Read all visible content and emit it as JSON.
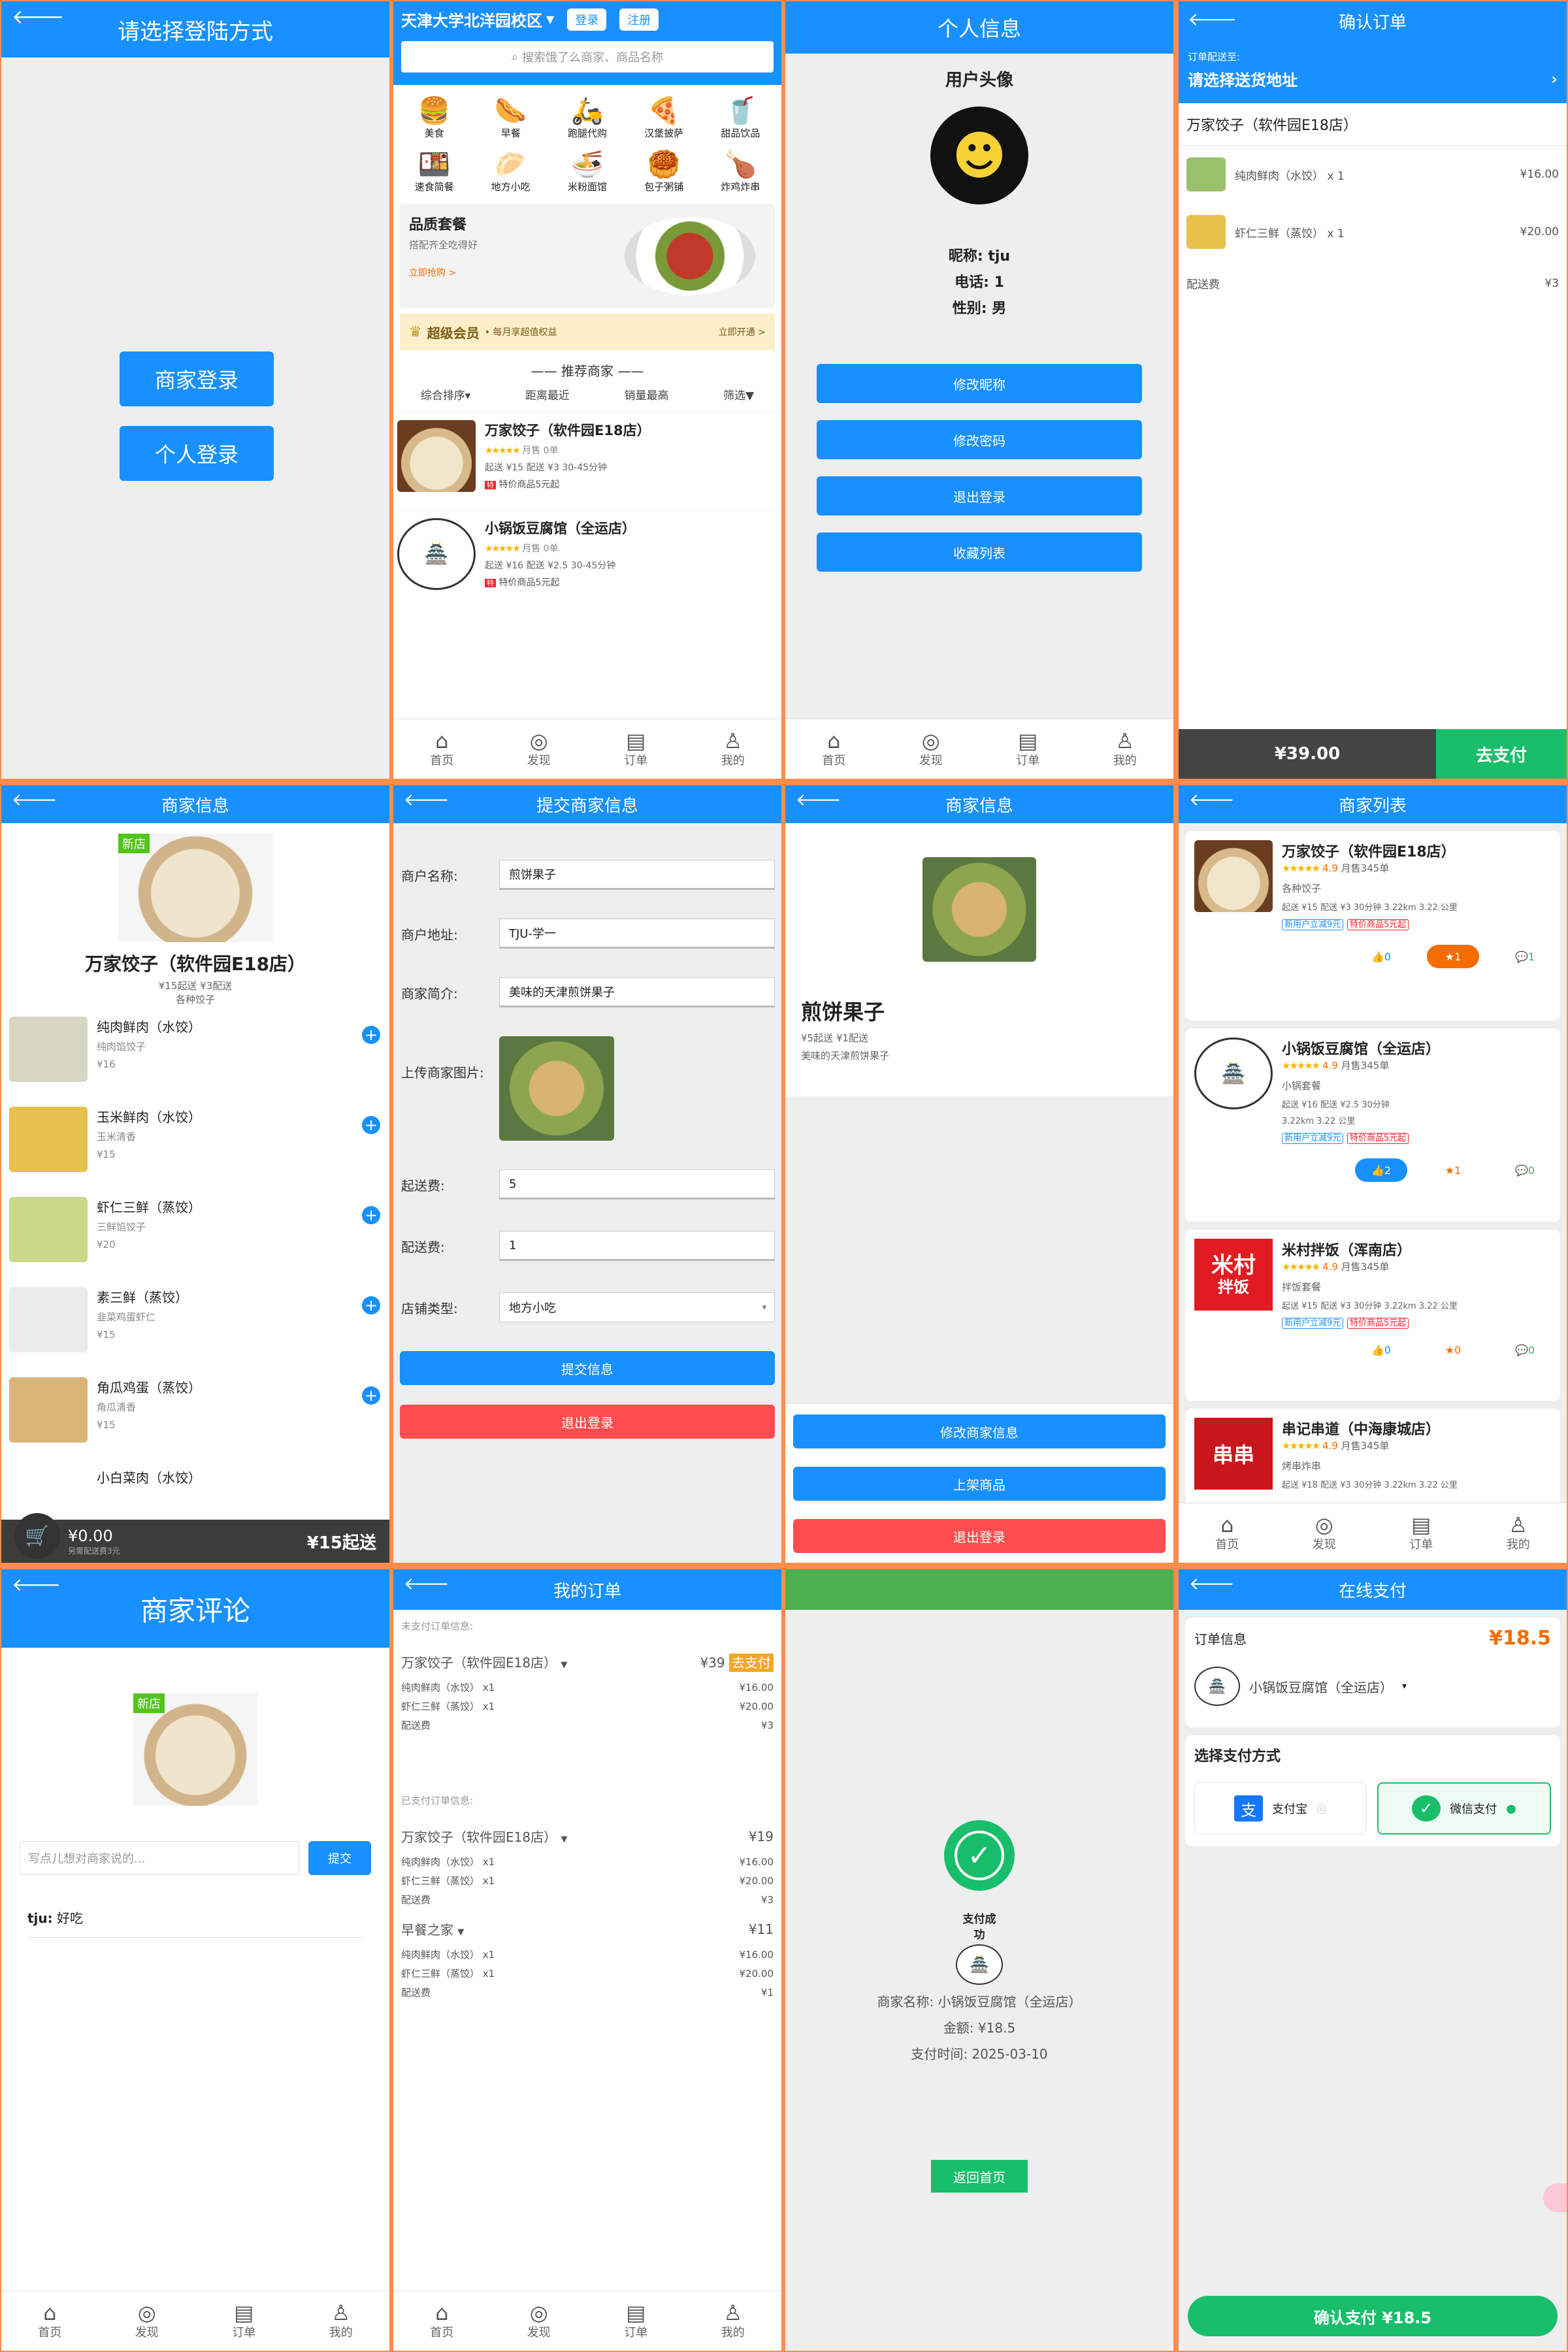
{
  "tabbar": [
    "首页",
    "发现",
    "订单",
    "我的"
  ],
  "login": {
    "title": "请选择登陆方式",
    "merchant_btn": "商家登录",
    "personal_btn": "个人登录"
  },
  "home": {
    "location": "天津大学北洋园校区",
    "login": "登录",
    "register": "注册",
    "search_placeholder": "搜索饿了么商家、商品名称",
    "cats": [
      "美食",
      "早餐",
      "跑腿代购",
      "汉堡披萨",
      "甜品饮品",
      "速食简餐",
      "地方小吃",
      "米粉面馆",
      "包子粥铺",
      "炸鸡炸串"
    ],
    "banner_title": "品质套餐",
    "banner_sub": "搭配齐全吃得好",
    "banner_link": "立即抢购 >",
    "vip": "超级会员",
    "vip_sub": "• 每月享超值权益",
    "vip_link": "立即开通 >",
    "rec_title": "推荐商家",
    "sorts": [
      "综合排序▾",
      "距离最近",
      "销量最高",
      "筛选▼"
    ],
    "shops": [
      {
        "name": "万家饺子（软件园E18店）",
        "sales": "月售 0单",
        "fee": "起送 ¥15  配送 ¥3  30-45分钟",
        "promo": "特价商品5元起"
      },
      {
        "name": "小锅饭豆腐馆（全运店）",
        "sales": "月售 0单",
        "fee": "起送 ¥16  配送 ¥2.5  30-45分钟",
        "promo": "特价商品5元起"
      }
    ]
  },
  "profile": {
    "title": "个人信息",
    "avatar_label": "用户头像",
    "nick": "昵称: tju",
    "phone": "电话: 1",
    "gender": "性别: 男",
    "buttons": [
      "修改昵称",
      "修改密码",
      "退出登录",
      "收藏列表"
    ]
  },
  "confirm": {
    "title": "确认订单",
    "deliver_to": "订单配送至:",
    "choose_addr": "请选择送货地址",
    "shop": "万家饺子（软件园E18店）",
    "items": [
      {
        "name": "纯肉鲜肉（水饺） x 1",
        "price": "¥16.00"
      },
      {
        "name": "虾仁三鲜（蒸饺） x 1",
        "price": "¥20.00"
      }
    ],
    "fee_label": "配送费",
    "fee": "¥3",
    "total": "¥39.00",
    "pay": "去支付"
  },
  "shopinfo": {
    "title": "商家信息",
    "name": "万家饺子（软件园E18店）",
    "meta": "¥15起送 ¥3配送",
    "desc": "各种饺子",
    "items": [
      {
        "name": "纯肉鲜肉（水饺）",
        "desc": "纯肉馅饺子",
        "price": "¥16"
      },
      {
        "name": "玉米鲜肉（水饺）",
        "desc": "玉米清香",
        "price": "¥15"
      },
      {
        "name": "虾仁三鲜（蒸饺）",
        "desc": "三鲜馅饺子",
        "price": "¥20"
      },
      {
        "name": "素三鲜（蒸饺）",
        "desc": "韭菜鸡蛋虾仁",
        "price": "¥15"
      },
      {
        "name": "角瓜鸡蛋（蒸饺）",
        "desc": "角瓜清香",
        "price": "¥15"
      },
      {
        "name": "小白菜肉（水饺）",
        "desc": "",
        "price": ""
      }
    ],
    "cart_amount": "¥0.00",
    "cart_note": "另需配送费3元",
    "min_order": "¥15起送",
    "new_tag": "新店"
  },
  "submit": {
    "title": "提交商家信息",
    "fields": [
      {
        "label": "商户名称:",
        "value": "煎饼果子"
      },
      {
        "label": "商户地址:",
        "value": "TJU-学一"
      },
      {
        "label": "商家简介:",
        "value": "美味的天津煎饼果子"
      }
    ],
    "upload_label": "上传商家图片:",
    "fields2": [
      {
        "label": "起送费:",
        "value": "5"
      },
      {
        "label": "配送费:",
        "value": "1"
      },
      {
        "label": "店铺类型:",
        "value": "地方小吃"
      }
    ],
    "submit_btn": "提交信息",
    "logout_btn": "退出登录"
  },
  "merchant": {
    "title": "商家信息",
    "name": "煎饼果子",
    "meta": "¥5起送 ¥1配送",
    "desc": "美味的天津煎饼果子",
    "buttons": [
      "修改商家信息",
      "上架商品",
      "退出登录"
    ]
  },
  "shoplist": {
    "title": "商家列表",
    "shops": [
      {
        "name": "万家饺子（软件园E18店）",
        "rating": "4.9",
        "sales": "月售345单",
        "cat": "各种饺子",
        "fee": "起送 ¥15   配送 ¥3   30分钟   3.22km  3.22 公里",
        "likes": "0",
        "stars": "1",
        "comments": "1",
        "tag1": "新用户立减9元",
        "tag2": "特价商品5元起"
      },
      {
        "name": "小锅饭豆腐馆（全运店）",
        "rating": "4.9",
        "sales": "月售345单",
        "cat": "小锅套餐",
        "fee": "起送 ¥16   配送 ¥2.5   30分钟",
        "fee2": "3.22km  3.22 公里",
        "likes": "2",
        "stars": "1",
        "comments": "0",
        "tag1": "新用户立减9元",
        "tag2": "特价商品5元起"
      },
      {
        "name": "米村拌饭（浑南店）",
        "rating": "4.9",
        "sales": "月售345单",
        "cat": "拌饭套餐",
        "fee": "起送 ¥15   配送 ¥3   30分钟   3.22km  3.22 公里",
        "likes": "0",
        "stars": "0",
        "comments": "0",
        "tag1": "新用户立减9元",
        "tag2": "特价商品5元起"
      },
      {
        "name": "串记串道（中海康城店）",
        "rating": "4.9",
        "sales": "月售345单",
        "cat": "烤串炸串",
        "fee": "起送 ¥18   配送 ¥3   30分钟   3.22km  3.22 公里"
      }
    ]
  },
  "reviews": {
    "title": "商家评论",
    "placeholder": "写点儿想对商家说的...",
    "submit": "提交",
    "comment_user": "tju:",
    "comment_text": "好吃"
  },
  "orders": {
    "title": "我的订单",
    "unpaid_label": "未支付订单信息:",
    "paid_label": "已支付订单信息:",
    "unpaid": [
      {
        "shop": "万家饺子（软件园E18店）",
        "total": "¥39",
        "pay": "去支付",
        "lines": [
          [
            "纯肉鲜肉（水饺） x1",
            "¥16.00"
          ],
          [
            "虾仁三鲜（蒸饺） x1",
            "¥20.00"
          ],
          [
            "配送费",
            "¥3"
          ]
        ]
      }
    ],
    "paid": [
      {
        "shop": "万家饺子（软件园E18店）",
        "total": "¥19",
        "lines": [
          [
            "纯肉鲜肉（水饺） x1",
            "¥16.00"
          ],
          [
            "虾仁三鲜（蒸饺） x1",
            "¥20.00"
          ],
          [
            "配送费",
            "¥3"
          ]
        ]
      },
      {
        "shop": "早餐之家",
        "total": "¥11",
        "lines": [
          [
            "纯肉鲜肉（水饺） x1",
            "¥16.00"
          ],
          [
            "虾仁三鲜（蒸饺） x1",
            "¥20.00"
          ],
          [
            "配送费",
            "¥1"
          ]
        ]
      }
    ]
  },
  "success": {
    "status": "支付成功",
    "shop": "商家名称: 小锅饭豆腐馆（全运店）",
    "amount": "金额: ¥18.5",
    "time": "支付时间: 2025-03-10",
    "home_btn": "返回首页"
  },
  "pay": {
    "title": "在线支付",
    "order_info": "订单信息",
    "amount": "¥18.5",
    "shop": "小锅饭豆腐馆（全运店）",
    "choose": "选择支付方式",
    "alipay": "支付宝",
    "wechat": "微信支付",
    "confirm": "确认支付 ¥18.5"
  },
  "colors": {
    "primary": "#1890ff",
    "danger": "#ff4d4f",
    "success": "#19be6b",
    "dark": "#444444"
  }
}
